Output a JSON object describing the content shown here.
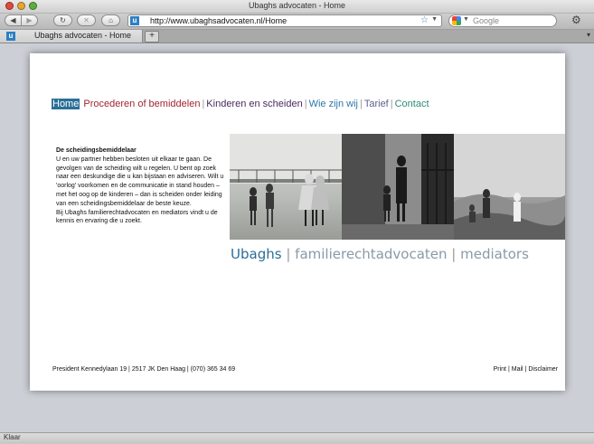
{
  "window": {
    "title": "Ubaghs advocaten - Home"
  },
  "toolbar": {
    "back_icon": "◀",
    "forward_icon": "▶",
    "reload_icon": "↻",
    "stop_icon": "✕",
    "home_icon": "⌂",
    "url": "http://www.ubaghsadvocaten.nl/Home",
    "bookmark_icon": "☆",
    "url_dropdown": "▼",
    "search_placeholder": "Google",
    "search_dropdown": "▼",
    "gear_icon": "⚙"
  },
  "tabs": {
    "items": [
      {
        "label": "Ubaghs advocaten - Home",
        "favicon": "u"
      }
    ],
    "add_label": "+",
    "list_icon": "▾"
  },
  "site": {
    "menu": {
      "home": "Home",
      "procederen": "Procederen of bemiddelen",
      "kinderen": "Kinderen en scheiden",
      "wie": "Wie zijn wij",
      "tarief": "Tarief",
      "contact": "Contact",
      "separator": "|"
    },
    "intro": {
      "title": "De scheidingsbemiddelaar",
      "p1": "U en uw partner hebben besloten uit elkaar te gaan. De gevolgen van de scheiding wilt u regelen. U bent op zoek naar een deskundige die u kan bijstaan en adviseren. Wilt u 'oorlog' voorkomen en de communicatie in stand houden – met het oog op de kinderen – dan is scheiden onder leiding van een scheidingsbemiddelaar de beste keuze.",
      "p2": "Bij Ubaghs familierechtadvocaten en mediators vindt u de kennis en ervaring die u zoekt."
    },
    "brand": {
      "name": "Ubaghs",
      "sep": "|",
      "part2": "familierechtadvocaten",
      "part3": "mediators"
    },
    "footer": {
      "address": "President Kennedylaan 19 | 2517 JK Den Haag | (070) 365 34 69",
      "print": "Print",
      "mail": "Mail",
      "disclaimer": "Disclaimer",
      "sep": "|"
    }
  },
  "status": {
    "text": "Klaar"
  }
}
